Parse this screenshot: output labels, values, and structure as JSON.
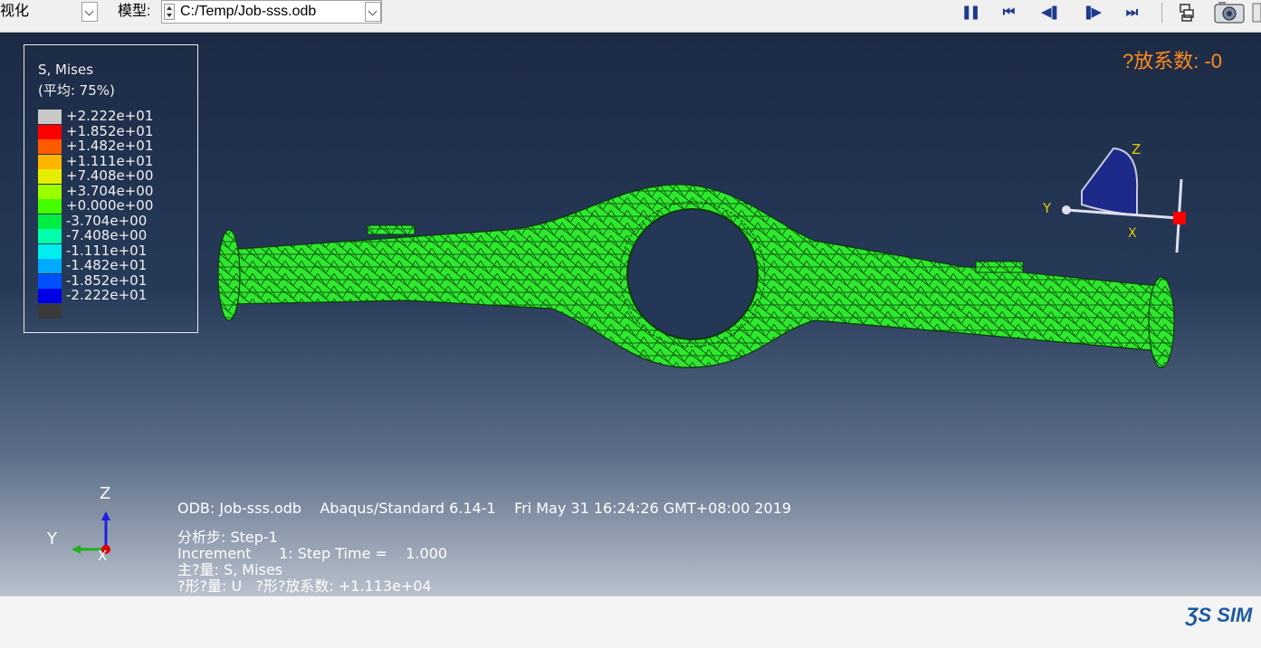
{
  "toolbar": {
    "module_value": "视化",
    "model_label": "模型:",
    "model_value": "C:/Temp/Job-sss.odb",
    "anim_buttons": [
      {
        "name": "pause-button",
        "glyph": "❚❚"
      },
      {
        "name": "first-frame-button",
        "glyph": "⏮"
      },
      {
        "name": "previous-frame-button",
        "glyph": "◀❚"
      },
      {
        "name": "next-frame-button",
        "glyph": "❚▶"
      },
      {
        "name": "last-frame-button",
        "glyph": "⏭"
      }
    ]
  },
  "legend": {
    "title": "S, Mises",
    "subtitle": "(平均: 75%)",
    "entries": [
      {
        "value": "+2.222e+01",
        "color": "#c8c8c8"
      },
      {
        "value": "+1.852e+01",
        "color": "#ff0000"
      },
      {
        "value": "+1.482e+01",
        "color": "#ff5a00"
      },
      {
        "value": "+1.111e+01",
        "color": "#ffb400"
      },
      {
        "value": "+7.408e+00",
        "color": "#e6ee00"
      },
      {
        "value": "+3.704e+00",
        "color": "#9cff00"
      },
      {
        "value": "+0.000e+00",
        "color": "#44ff00"
      },
      {
        "value": "-3.704e+00",
        "color": "#00ee44"
      },
      {
        "value": "-7.408e+00",
        "color": "#00ffaa"
      },
      {
        "value": "-1.111e+01",
        "color": "#00eeee"
      },
      {
        "value": "-1.482e+01",
        "color": "#00aaff"
      },
      {
        "value": "-1.852e+01",
        "color": "#0050ff"
      },
      {
        "value": "-2.222e+01",
        "color": "#0000e6"
      },
      {
        "value": "",
        "color": "#3a3a3a"
      }
    ]
  },
  "scale_factor_label": "?放系数: -0",
  "info": {
    "line1": "ODB: Job-sss.odb    Abaqus/Standard 6.14-1    Fri May 31 16:24:26 GMT+08:00 2019",
    "line2": "分析步: Step-1",
    "line3": "Increment      1: Step Time =    1.000",
    "line4": "主?量: S, Mises",
    "line5": "?形?量: U   ?形?放系数: +1.113e+04"
  },
  "triad": {
    "z": "Z",
    "y": "Y",
    "x": "X"
  },
  "view_cube": {
    "z": "Z",
    "y": "Y",
    "x": "X"
  },
  "brand": "ƷS SIM",
  "colors": {
    "mesh_fill": "#2ee82e",
    "mesh_line": "#0a3a0a",
    "scale_text": "#ff8c1a",
    "anim_icon": "#1e3a8a"
  }
}
